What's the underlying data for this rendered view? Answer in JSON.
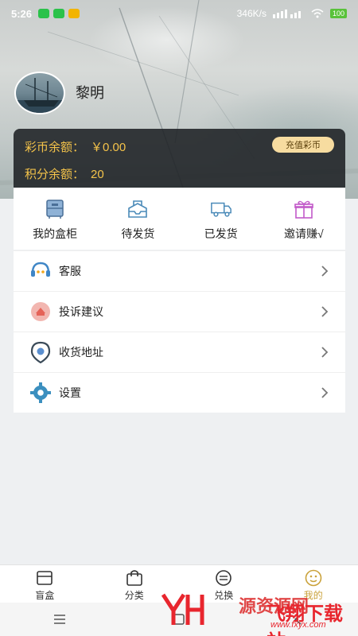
{
  "status_bar": {
    "time": "5:26",
    "net_speed": "346K/s",
    "battery": "100",
    "app_icons": [
      "wechat-icon",
      "wechat-icon",
      "mail-icon"
    ]
  },
  "profile": {
    "username": "黎明"
  },
  "balance": {
    "coin_label": "彩币余额：",
    "coin_value": "￥0.00",
    "points_label": "积分余额：",
    "points_value": "20",
    "recharge_label": "充值彩币",
    "accent_color": "#f4c34a"
  },
  "orders": [
    {
      "label": "我的盒柜",
      "icon": "cabinet-icon"
    },
    {
      "label": "待发货",
      "icon": "box-open-icon"
    },
    {
      "label": "已发货",
      "icon": "truck-icon"
    },
    {
      "label": "邀请赚√",
      "icon": "gift-icon"
    }
  ],
  "menu": [
    {
      "label": "客服",
      "icon": "customer-service-icon"
    },
    {
      "label": "投诉建议",
      "icon": "complaint-icon"
    },
    {
      "label": "收货地址",
      "icon": "location-icon"
    },
    {
      "label": "设置",
      "icon": "gear-icon"
    }
  ],
  "bottom_nav": [
    {
      "label": "盲盒",
      "icon": "blindbox-icon",
      "active": false
    },
    {
      "label": "分类",
      "icon": "bag-icon",
      "active": false
    },
    {
      "label": "兑换",
      "icon": "exchange-icon",
      "active": false
    },
    {
      "label": "我的",
      "icon": "profile-icon",
      "active": true
    }
  ],
  "watermark": {
    "left_text": "源资源网",
    "right_text": "飞翔下载站",
    "url": "www.fxyx.com"
  }
}
